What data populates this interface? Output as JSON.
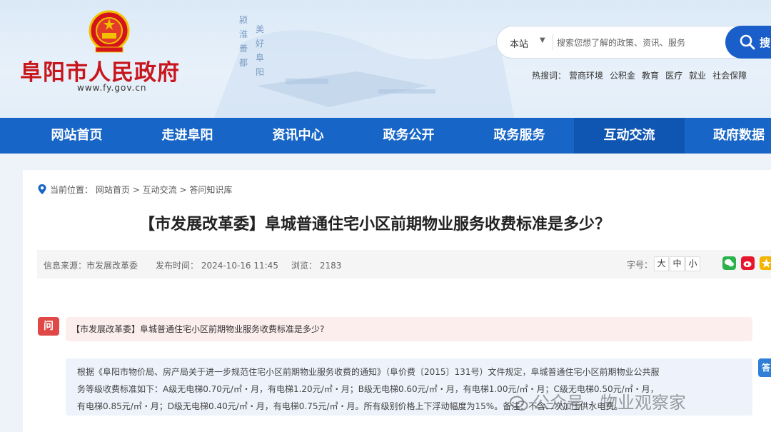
{
  "header": {
    "site_name": "阜阳市人民政府",
    "site_url": "www.fy.gov.cn",
    "calligraphy": [
      "颍",
      "淮",
      "善",
      "都",
      "美",
      "好",
      "阜",
      "阳"
    ],
    "search": {
      "scope": "本站",
      "placeholder": "搜索您想了解的政策、资讯、服务",
      "button_label": "搜"
    },
    "hot_label": "热搜词：",
    "hot_words": [
      "营商环境",
      "公积金",
      "教育",
      "医疗",
      "就业",
      "社会保障"
    ]
  },
  "nav": {
    "items": [
      "网站首页",
      "走进阜阳",
      "资讯中心",
      "政务公开",
      "政务服务",
      "互动交流",
      "政府数据"
    ],
    "active": "互动交流"
  },
  "breadcrumb": {
    "label": "当前位置：",
    "items": [
      "网站首页",
      "互动交流",
      "答问知识库"
    ],
    "sep": ">"
  },
  "article": {
    "title": "【市发展改革委】阜城普通住宅小区前期物业服务收费标准是多少？",
    "source": "信息来源：市发展改革委",
    "publish_time": "发布时间：  2024-10-16 11:45",
    "views": "浏览：  2183",
    "font_label": "字号：",
    "font_sizes": [
      "大",
      "中",
      "小"
    ],
    "share_colors": [
      "#2bb24c",
      "#e6162d",
      "#f5b400"
    ]
  },
  "qa": {
    "q_icon": "问",
    "question": "【市发展改革委】阜城普通住宅小区前期物业服务收费标准是多少?",
    "a_icon": "答",
    "answer_lines": [
      "根据《阜阳市物价局、房产局关于进一步规范住宅小区前期物业服务收费的通知》（阜价费〔2015〕131号）文件规定，阜城普通住宅小区前期物业公共服",
      "务等级收费标准如下：A级无电梯0.70元/㎡・月，有电梯1.20元/㎡・月；B级无电梯0.60元/㎡・月，有电梯1.00元/㎡・月；C级无电梯0.50元/㎡・月，",
      "有电梯0.85元/㎡・月；D级无电梯0.40元/㎡・月，有电梯0.75元/㎡・月。所有级别价格上下浮动幅度为15%。备注：不含二次加压供水电费。"
    ]
  },
  "watermark": "公众号 · 物业观察家",
  "colors": {
    "nav_blue": "#1766c7",
    "title_red": "#c8161d",
    "q_red": "#e04848"
  }
}
